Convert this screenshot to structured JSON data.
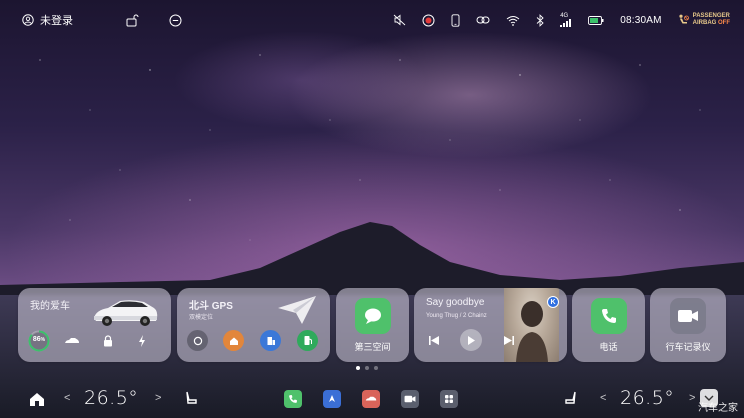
{
  "status_bar": {
    "user_label": "未登录",
    "time": "08:30AM",
    "signal": "4G",
    "airbag_line1": "PASSENGER",
    "airbag_line2": "AIRBAG",
    "airbag_state": "OFF",
    "icons": [
      "user-icon",
      "lock-icon",
      "minus-circle-icon",
      "mute-icon",
      "record-icon",
      "phone-outline-icon",
      "link-icon",
      "wifi-icon",
      "bluetooth-icon",
      "signal-icon",
      "battery-icon",
      "airbag-icon"
    ]
  },
  "cards": {
    "my_car": {
      "title": "我的爱车",
      "battery_percent": "86",
      "battery_unit": "%"
    },
    "gps": {
      "title": "北斗 GPS",
      "subtitle": "双模定位"
    },
    "space": {
      "label": "第三空间"
    },
    "music": {
      "title": "Say goodbye",
      "artist": "Young Thug / 2 Chainz",
      "badge": "K"
    },
    "phone": {
      "label": "电话"
    },
    "recorder": {
      "label": "行车记录仪"
    }
  },
  "bottom_bar": {
    "temp_left": "26.5°",
    "temp_right": "26.5°",
    "left_arrow": "<",
    "right_arrow": ">"
  },
  "watermark": "汽车之家",
  "colors": {
    "accent_green": "#3cc16b",
    "phone_green": "#4fc16b",
    "airbag_off": "#ff8b4a",
    "nav_orange": "#e2863b",
    "nav_blue": "#3b78d8",
    "nav_green": "#2faa5c"
  }
}
